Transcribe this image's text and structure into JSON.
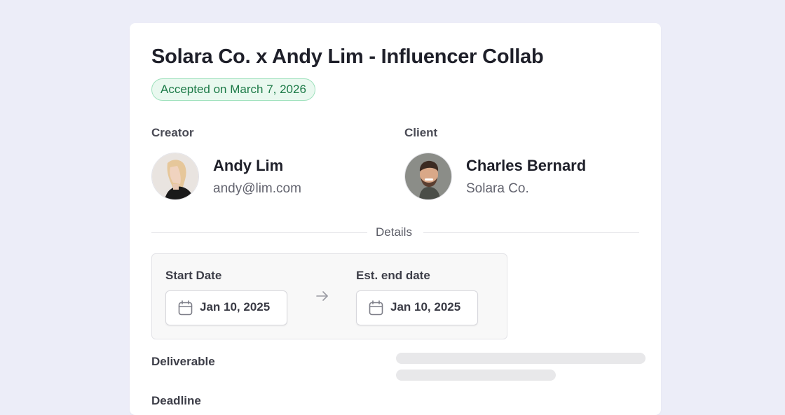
{
  "header": {
    "title": "Solara Co. x Andy Lim - Influencer Collab",
    "status_badge": "Accepted on March 7, 2026"
  },
  "creator": {
    "section_label": "Creator",
    "name": "Andy Lim",
    "email": "andy@lim.com"
  },
  "client": {
    "section_label": "Client",
    "name": "Charles Bernard",
    "company": "Solara Co."
  },
  "details": {
    "divider_label": "Details",
    "start": {
      "label": "Start Date",
      "value": "Jan 10, 2025",
      "icon": "calendar-icon"
    },
    "end": {
      "label": "Est. end date",
      "value": "Jan 10, 2025",
      "icon": "calendar-icon"
    },
    "arrow_icon": "arrow-right-icon"
  },
  "rows": [
    {
      "label": "Deliverable"
    },
    {
      "label": "Deadline"
    }
  ],
  "colors": {
    "page_bg": "#ecedf8",
    "badge_bg": "#e9f8ef",
    "badge_border": "#9fe1bd",
    "badge_text": "#1c7a47"
  }
}
